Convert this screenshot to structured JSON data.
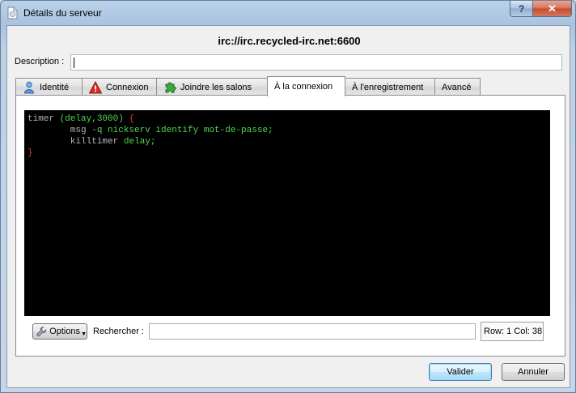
{
  "window": {
    "title": "Détails du serveur",
    "help_label": "?",
    "close_label": "✕"
  },
  "server": {
    "name": "irc://irc.recycled-irc.net:6600"
  },
  "description": {
    "label": "Description :",
    "value": ""
  },
  "tabs": [
    {
      "label": "Identité",
      "icon": "user-icon"
    },
    {
      "label": "Connexion",
      "icon": "warning-icon"
    },
    {
      "label": "Joindre les salons",
      "icon": "puzzle-icon"
    },
    {
      "label": "À la connexion",
      "icon": null,
      "active": true
    },
    {
      "label": "À l'enregistrement",
      "icon": null
    },
    {
      "label": "Avancé",
      "icon": null
    }
  ],
  "editor": {
    "lines": [
      [
        {
          "t": "timer ",
          "c": "gray"
        },
        {
          "t": "(delay,3000) ",
          "c": "green"
        },
        {
          "t": "{",
          "c": "red"
        }
      ],
      [
        {
          "t": "        msg ",
          "c": "gray"
        },
        {
          "t": "-q nickserv identify mot-de-passe;",
          "c": "green"
        }
      ],
      [
        {
          "t": "        killtimer ",
          "c": "gray"
        },
        {
          "t": "delay;",
          "c": "green"
        }
      ],
      [
        {
          "t": "}",
          "c": "red"
        }
      ]
    ]
  },
  "footer": {
    "options_label": "Options",
    "search_label": "Rechercher :",
    "search_value": "",
    "rowcol": "Row: 1 Col: 38"
  },
  "buttons": {
    "validate": "Valider",
    "cancel": "Annuler"
  },
  "colors": {
    "editor_bg": "#000000",
    "keyword_green": "#4fd64f",
    "brace_red": "#e03a2a",
    "default_button_accent": "#3c7fb1"
  }
}
